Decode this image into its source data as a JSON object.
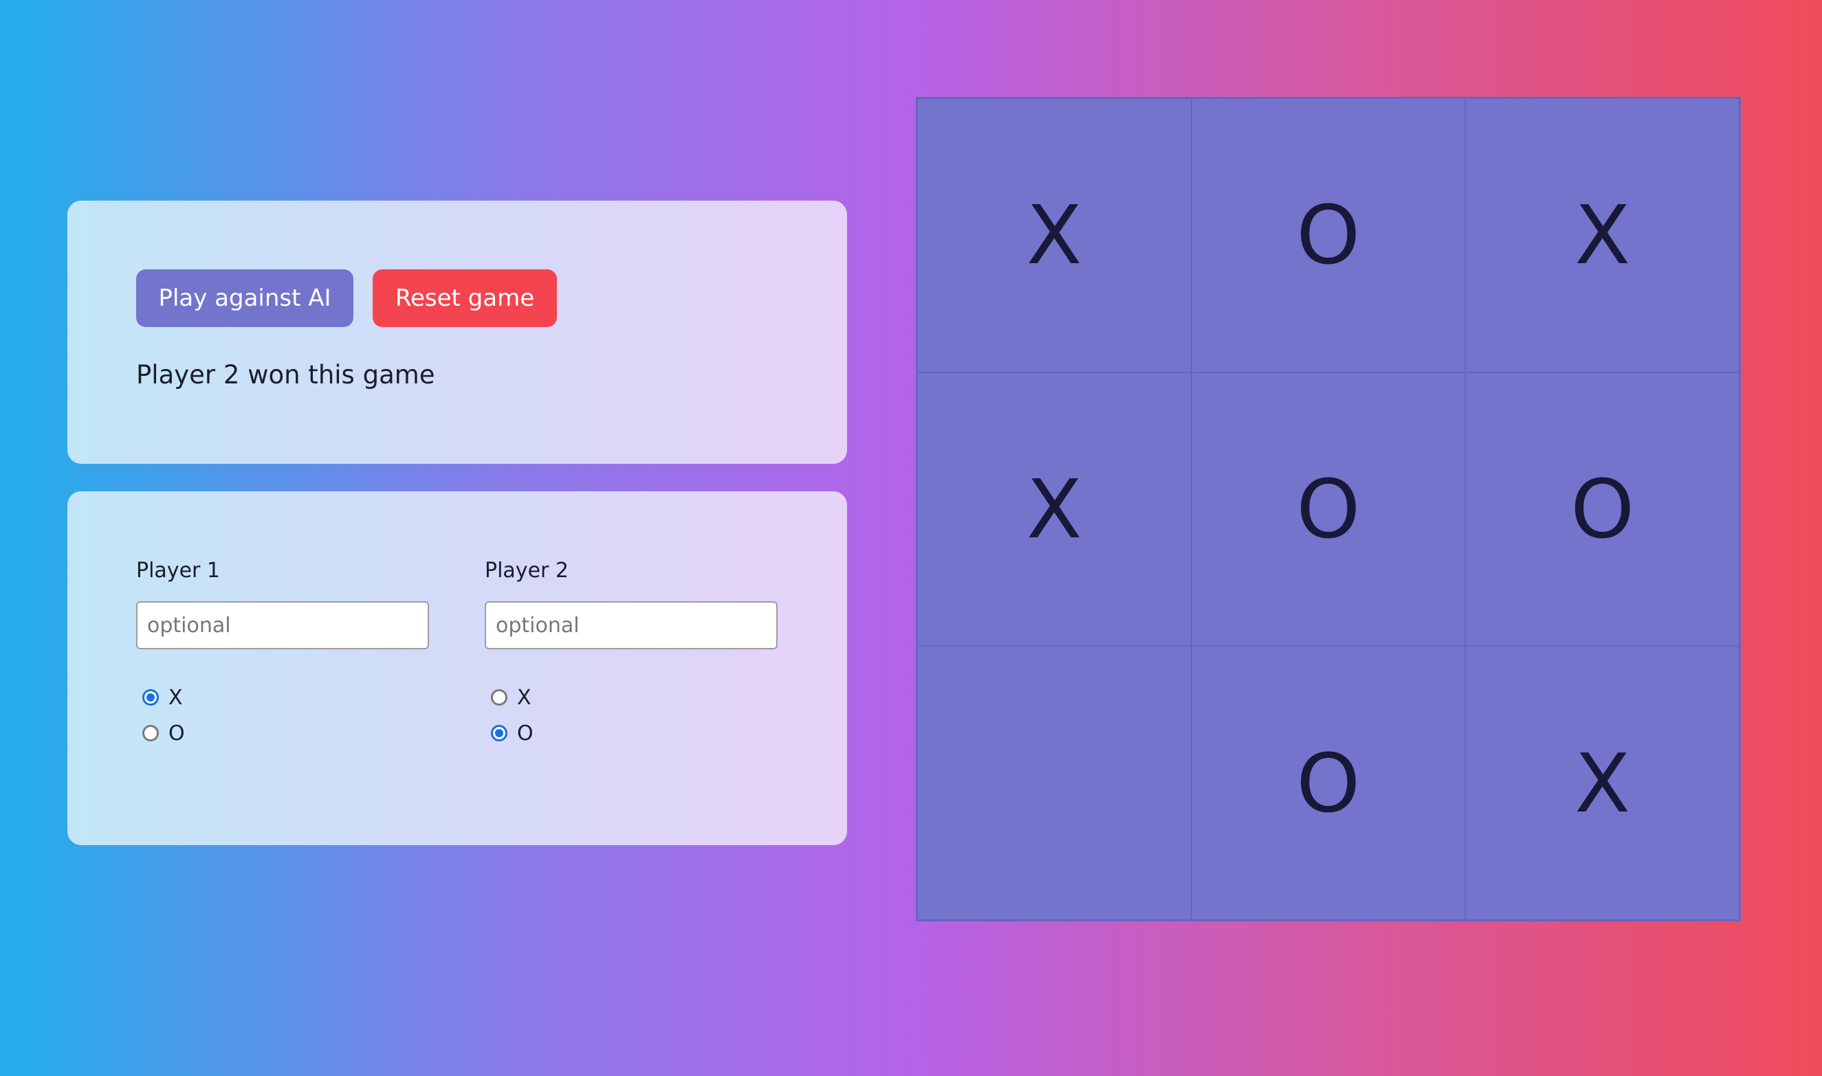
{
  "controls": {
    "play_ai_label": "Play against AI",
    "reset_label": "Reset game",
    "status_text": "Player 2 won this game"
  },
  "players": [
    {
      "label": "Player 1",
      "name_value": "",
      "placeholder": "optional",
      "options": [
        {
          "label": "X",
          "checked": true
        },
        {
          "label": "O",
          "checked": false
        }
      ]
    },
    {
      "label": "Player 2",
      "name_value": "",
      "placeholder": "optional",
      "options": [
        {
          "label": "X",
          "checked": false
        },
        {
          "label": "O",
          "checked": true
        }
      ]
    }
  ],
  "board": {
    "cells": [
      "X",
      "O",
      "X",
      "X",
      "O",
      "O",
      "",
      "O",
      "X"
    ]
  },
  "colors": {
    "ai_button": "#7374cc",
    "reset_button": "#f4444f",
    "board_cell": "#7474cd",
    "radio_selected": "#1a6fe0"
  }
}
